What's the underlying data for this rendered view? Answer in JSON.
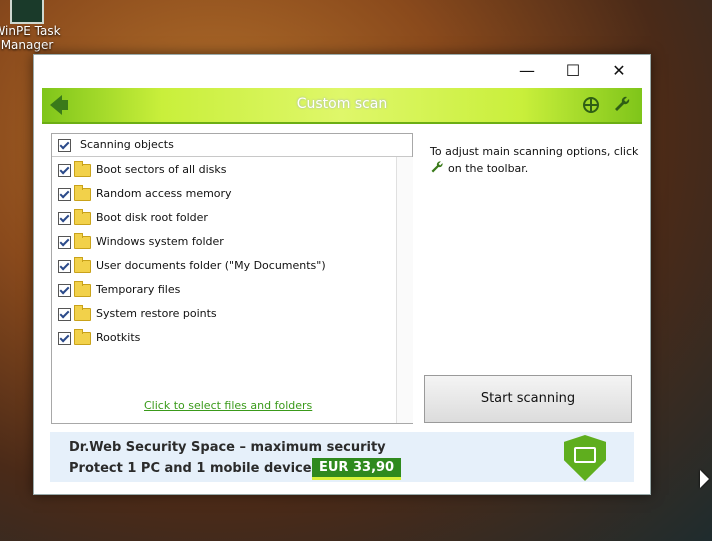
{
  "desktop": {
    "icon_label": "WinPE Task Manager"
  },
  "window": {
    "controls": {
      "minimize": "—",
      "maximize": "☐",
      "close": "✕"
    },
    "toolbar": {
      "title": "Custom scan"
    },
    "objects": {
      "header": "Scanning objects",
      "items": [
        "Boot sectors of all disks",
        "Random access memory",
        "Boot disk root folder",
        "Windows system folder",
        "User documents folder (\"My Documents\")",
        "Temporary files",
        "System restore points",
        "Rootkits"
      ],
      "link": "Click to select files and folders"
    },
    "hint": {
      "line1": "To adjust main scanning options, click",
      "line2": "on the toolbar."
    },
    "start_button": "Start scanning",
    "banner": {
      "line1": "Dr.Web Security Space – maximum security",
      "line2": "Protect 1 PC and 1 mobile device for",
      "price": "EUR 33,90"
    }
  },
  "colors": {
    "accent": "#7fc51a",
    "link": "#3a9a1a",
    "price_bg": "#2f8a1e"
  }
}
